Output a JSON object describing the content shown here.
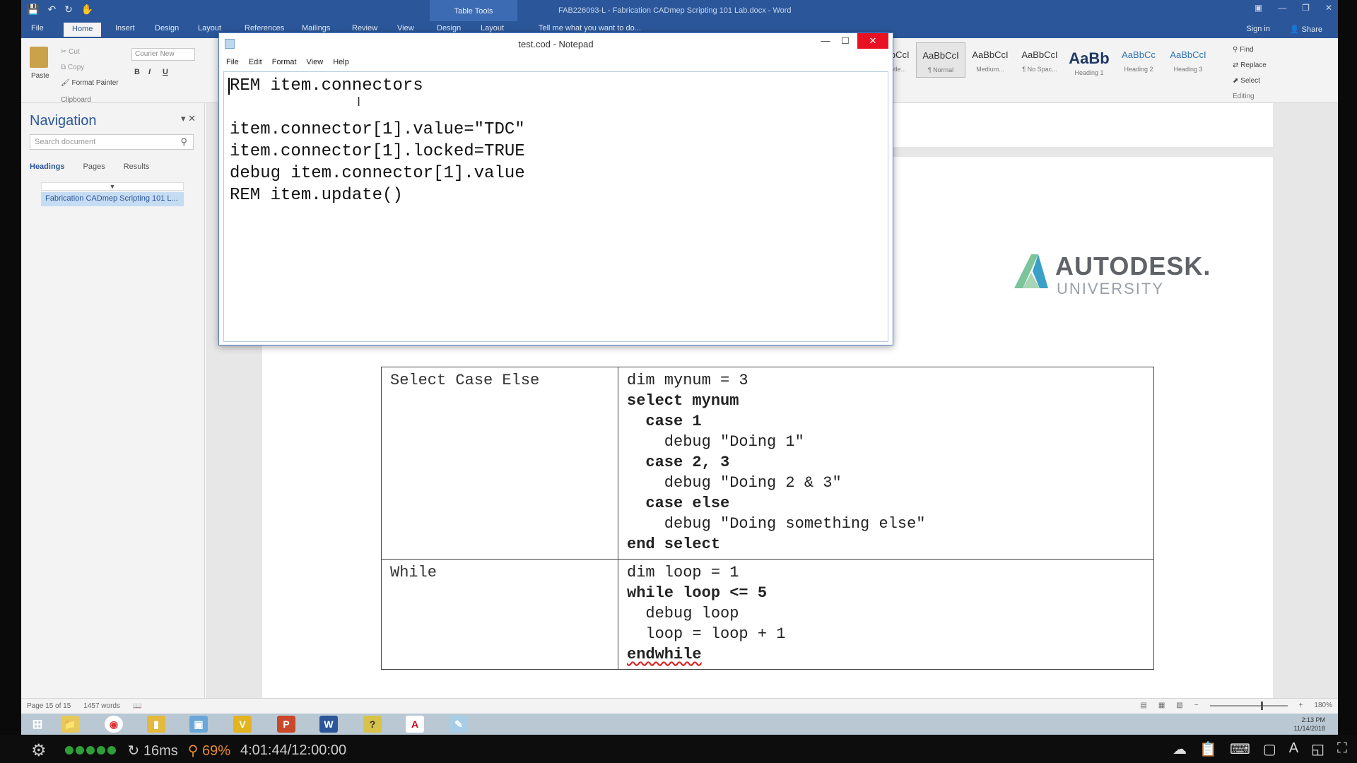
{
  "word": {
    "contextual_tab": "Table Tools",
    "title": "FAB226093-L - Fabrication CADmep Scripting 101 Lab.docx - Word",
    "tabs": [
      "File",
      "Home",
      "Insert",
      "Design",
      "Layout",
      "References",
      "Mailings",
      "Review",
      "View",
      "Design",
      "Layout"
    ],
    "tell_me": "Tell me what you want to do...",
    "sign_in": "Sign in",
    "share": "Share",
    "clipboard": {
      "paste": "Paste",
      "cut": "Cut",
      "copy": "Copy",
      "format_painter": "Format Painter",
      "group": "Clipboard"
    },
    "font_name": "Courier New",
    "styles": [
      {
        "sample": "AaBbCcI",
        "label": "U Subtle..."
      },
      {
        "sample": "AaBbCcI",
        "label": "¶ Normal"
      },
      {
        "sample": "AaBbCcI",
        "label": "Medium..."
      },
      {
        "sample": "AaBbCcI",
        "label": "¶ No Spac..."
      },
      {
        "sample": "AaBb",
        "label": "Heading 1"
      },
      {
        "sample": "AaBbCc",
        "label": "Heading 2"
      },
      {
        "sample": "AaBbCcI",
        "label": "Heading 3"
      }
    ],
    "editing": {
      "find": "Find",
      "replace": "Replace",
      "select": "Select",
      "group": "Editing"
    }
  },
  "navigation": {
    "title": "Navigation",
    "search_placeholder": "Search document",
    "tabs": [
      "Headings",
      "Pages",
      "Results"
    ],
    "heading_item": "Fabrication CADmep Scripting 101 L..."
  },
  "notepad": {
    "title": "test.cod - Notepad",
    "menu": [
      "File",
      "Edit",
      "Format",
      "View",
      "Help"
    ],
    "lines": [
      "REM item.connectors",
      "",
      "item.connector[1].value=\"TDC\"",
      "item.connector[1].locked=TRUE",
      "debug item.connector[1].value",
      "REM item.update()"
    ]
  },
  "logo": {
    "brand": "AUTODESK.",
    "sub": "UNIVERSITY"
  },
  "table": {
    "select_label": "Select Case Else",
    "select_code": [
      "dim mynum = 3",
      "select mynum",
      "  case 1",
      "    debug \"Doing 1\"",
      "  case 2, 3",
      "    debug \"Doing 2 & 3\"",
      "  case else",
      "    debug \"Doing something else\"",
      "end select"
    ],
    "while_label": "While",
    "while_code": [
      "dim loop = 1",
      "while loop <= 5",
      "  debug loop",
      "  loop = loop + 1",
      "endwhile"
    ]
  },
  "status": {
    "page": "Page 15 of 15",
    "words": "1457 words",
    "zoom": "180%"
  },
  "taskbar": {
    "time": "2:13 PM",
    "date": "11/14/2018"
  },
  "recorder": {
    "latency": "16ms",
    "zoom": "69%",
    "time": "4:01:44/12:00:00"
  }
}
